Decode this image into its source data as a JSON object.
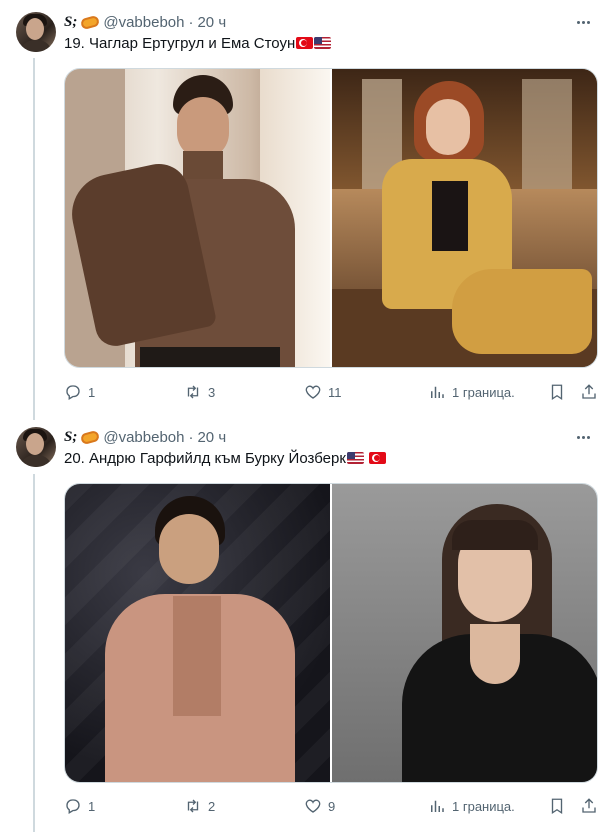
{
  "tweets": [
    {
      "name": "S;",
      "handle": "@vabbeboh",
      "dot": "·",
      "time": "20 ч",
      "text": "19. Чаглар Ертугрул и Ема Стоун",
      "flags": [
        "flag-tr",
        "flag-us"
      ],
      "replies": "1",
      "retweets": "3",
      "likes": "11",
      "views": "1 границa."
    },
    {
      "name": "S;",
      "handle": "@vabbeboh",
      "dot": "·",
      "time": "20 ч",
      "text": "20. Андрю Гарфийлд към Бурку Йозберк",
      "flags": [
        "flag-us",
        "flag-tr"
      ],
      "replies": "1",
      "retweets": "2",
      "likes": "9",
      "views": "1 границa."
    }
  ],
  "icons": {
    "more": "more-icon",
    "reply": "reply-icon",
    "retweet": "retweet-icon",
    "like": "heart-icon",
    "views": "analytics-icon",
    "bookmark": "bookmark-icon",
    "share": "share-icon"
  },
  "colors": {
    "text": "#0f1419",
    "muted": "#536471",
    "border": "#cfd9de"
  }
}
